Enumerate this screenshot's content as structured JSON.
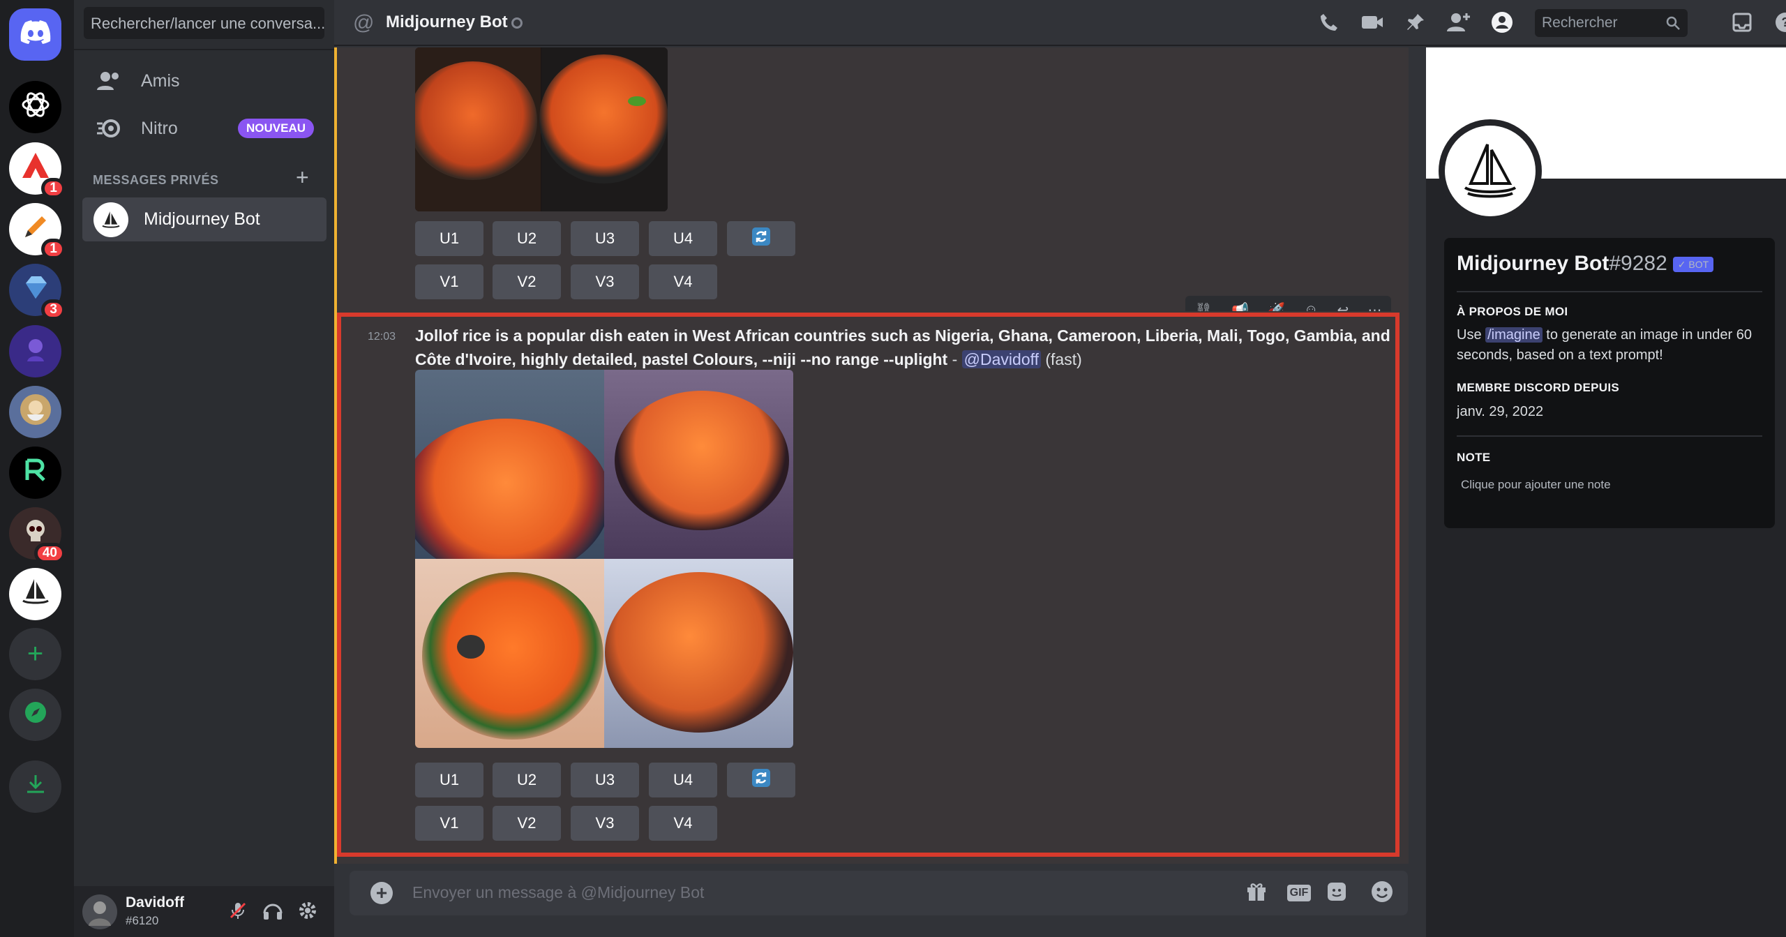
{
  "colors": {
    "accent": "#5865f2",
    "highlight_box": "#d83a2c",
    "mention_bg": "#3c4270"
  },
  "rail": {
    "home_icon": "discord-logo-icon",
    "servers": [
      {
        "name": "chatgpt-server",
        "badge": ""
      },
      {
        "name": "red-triangle-server",
        "badge": "1"
      },
      {
        "name": "pencil-server",
        "badge": "1"
      },
      {
        "name": "gem-server",
        "badge": "3"
      },
      {
        "name": "ai-art-server",
        "badge": ""
      },
      {
        "name": "wizard-server",
        "badge": ""
      },
      {
        "name": "r-logo-server",
        "badge": ""
      },
      {
        "name": "skull-server",
        "badge": "40"
      },
      {
        "name": "midjourney-server",
        "badge": ""
      }
    ]
  },
  "sidebar": {
    "search_placeholder": "Rechercher/lancer une conversa...",
    "friends_label": "Amis",
    "nitro_label": "Nitro",
    "nitro_badge": "NOUVEAU",
    "dm_heading": "MESSAGES PRIVÉS",
    "active_dm": "Midjourney Bot"
  },
  "user": {
    "name": "Davidoff",
    "tag": "#6120"
  },
  "header": {
    "title": "Midjourney Bot",
    "search_placeholder": "Rechercher"
  },
  "message1": {
    "buttons_row1": [
      "U1",
      "U2",
      "U3",
      "U4"
    ],
    "buttons_row2": [
      "V1",
      "V2",
      "V3",
      "V4"
    ]
  },
  "message2": {
    "time": "12:03",
    "prompt": "Jollof rice is a popular dish eaten in West African countries such as Nigeria, Ghana, Cameroon, Liberia, Mali, Togo, Gambia, and Côte d'Ivoire, highly detailed, pastel Colours, --niji --no range --uplight",
    "separator": " - ",
    "mention": "@Davidoff",
    "speed": "(fast)",
    "buttons_row1": [
      "U1",
      "U2",
      "U3",
      "U4"
    ],
    "buttons_row2": [
      "V1",
      "V2",
      "V3",
      "V4"
    ]
  },
  "composer": {
    "placeholder": "Envoyer un message à @Midjourney Bot",
    "gif_label": "GIF"
  },
  "profile": {
    "name": "Midjourney Bot",
    "discriminator": "#9282",
    "bot_tag": "✓ BOT",
    "about_heading": "À PROPOS DE MOI",
    "about_prefix": "Use ",
    "about_command": "/imagine",
    "about_suffix": " to generate an image in under 60 seconds, based on a text prompt!",
    "member_heading": "MEMBRE DISCORD DEPUIS",
    "member_since": "janv. 29, 2022",
    "note_heading": "NOTE",
    "note_placeholder": "Clique pour ajouter une note"
  }
}
